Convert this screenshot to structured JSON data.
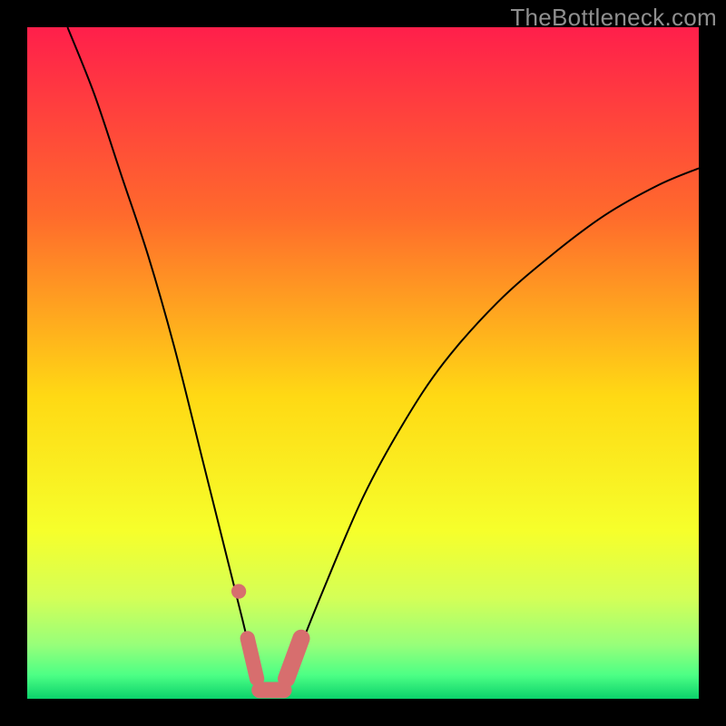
{
  "watermark": "TheBottleneck.com",
  "chart_data": {
    "type": "line",
    "title": "",
    "xlabel": "",
    "ylabel": "",
    "xlim": [
      0,
      100
    ],
    "ylim": [
      0,
      100
    ],
    "background_gradient": {
      "stops": [
        {
          "offset": 0.0,
          "color": "#ff1f4b"
        },
        {
          "offset": 0.28,
          "color": "#ff6a2c"
        },
        {
          "offset": 0.55,
          "color": "#ffd914"
        },
        {
          "offset": 0.75,
          "color": "#f6ff2b"
        },
        {
          "offset": 0.85,
          "color": "#d4ff57"
        },
        {
          "offset": 0.92,
          "color": "#97ff7a"
        },
        {
          "offset": 0.965,
          "color": "#4cff85"
        },
        {
          "offset": 1.0,
          "color": "#0bd16b"
        }
      ]
    },
    "series": [
      {
        "name": "bottleneck-curve",
        "x": [
          6,
          10,
          14,
          18,
          22,
          26,
          28,
          30,
          32,
          33.5,
          35,
          36,
          37,
          38.5,
          40,
          44,
          50,
          56,
          62,
          70,
          78,
          86,
          94,
          100
        ],
        "y": [
          100,
          90,
          78,
          66,
          52,
          36,
          28,
          20,
          12,
          6,
          2,
          0.5,
          0.5,
          2,
          6,
          16,
          30,
          41,
          50,
          59,
          66,
          72,
          76.5,
          79
        ],
        "stroke": "#000000",
        "stroke_width": 2
      }
    ],
    "markers": [
      {
        "name": "highlight-dot-left",
        "shape": "circle",
        "x": 31.5,
        "y": 16,
        "r": 1.1,
        "fill": "#d76e6e"
      },
      {
        "name": "highlight-band-left",
        "shape": "rounded-line",
        "x1": 32.8,
        "y1": 9,
        "x2": 34.2,
        "y2": 3,
        "width": 2.2,
        "fill": "#d76e6e"
      },
      {
        "name": "highlight-band-bottom",
        "shape": "rounded-line",
        "x1": 34.6,
        "y1": 1.3,
        "x2": 38.2,
        "y2": 1.3,
        "width": 2.4,
        "fill": "#d76e6e"
      },
      {
        "name": "highlight-band-right",
        "shape": "rounded-line",
        "x1": 38.6,
        "y1": 3,
        "x2": 40.8,
        "y2": 9,
        "width": 2.6,
        "fill": "#d76e6e"
      }
    ]
  }
}
